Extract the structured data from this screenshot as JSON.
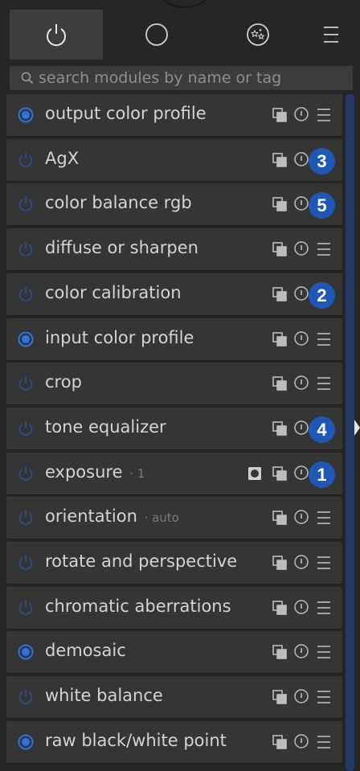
{
  "tabs": [
    {
      "name": "tab-active-modules",
      "icon": "power-icon",
      "active": true
    },
    {
      "name": "tab-all-modules",
      "icon": "circle-icon",
      "active": false
    },
    {
      "name": "tab-favorites",
      "icon": "stars-icon",
      "active": false
    },
    {
      "name": "tab-presets-menu",
      "icon": "menu-icon",
      "active": false
    }
  ],
  "search": {
    "placeholder": "search modules by name or tag",
    "icon": "search-icon"
  },
  "colors": {
    "accent": "#1f58b4",
    "enabled_power": "#2d73e6",
    "disabled_power": "#2a4f8c",
    "badge": "#1f58b4",
    "module_bg": "#353535",
    "panel_bg": "#262626"
  },
  "modules": [
    {
      "label": "output color profile",
      "suffix": "",
      "enabled": true,
      "badge": ""
    },
    {
      "label": "AgX",
      "suffix": "",
      "enabled": false,
      "badge": "3"
    },
    {
      "label": "color balance rgb",
      "suffix": "",
      "enabled": false,
      "badge": "5"
    },
    {
      "label": "diffuse or sharpen",
      "suffix": "",
      "enabled": false,
      "badge": ""
    },
    {
      "label": "color calibration",
      "suffix": "",
      "enabled": false,
      "badge": "2"
    },
    {
      "label": "input color profile",
      "suffix": "",
      "enabled": true,
      "badge": ""
    },
    {
      "label": "crop",
      "suffix": "",
      "enabled": false,
      "badge": ""
    },
    {
      "label": "tone equalizer",
      "suffix": "",
      "enabled": false,
      "badge": "4"
    },
    {
      "label": "exposure",
      "suffix": "· 1",
      "enabled": false,
      "badge": "1",
      "mask": true
    },
    {
      "label": "orientation",
      "suffix": "· auto",
      "enabled": false,
      "badge": ""
    },
    {
      "label": "rotate and perspective",
      "suffix": "",
      "enabled": false,
      "badge": ""
    },
    {
      "label": "chromatic aberrations",
      "suffix": "",
      "enabled": false,
      "badge": ""
    },
    {
      "label": "demosaic",
      "suffix": "",
      "enabled": true,
      "badge": ""
    },
    {
      "label": "white balance",
      "suffix": "",
      "enabled": false,
      "badge": ""
    },
    {
      "label": "raw black/white point",
      "suffix": "",
      "enabled": true,
      "badge": ""
    }
  ]
}
